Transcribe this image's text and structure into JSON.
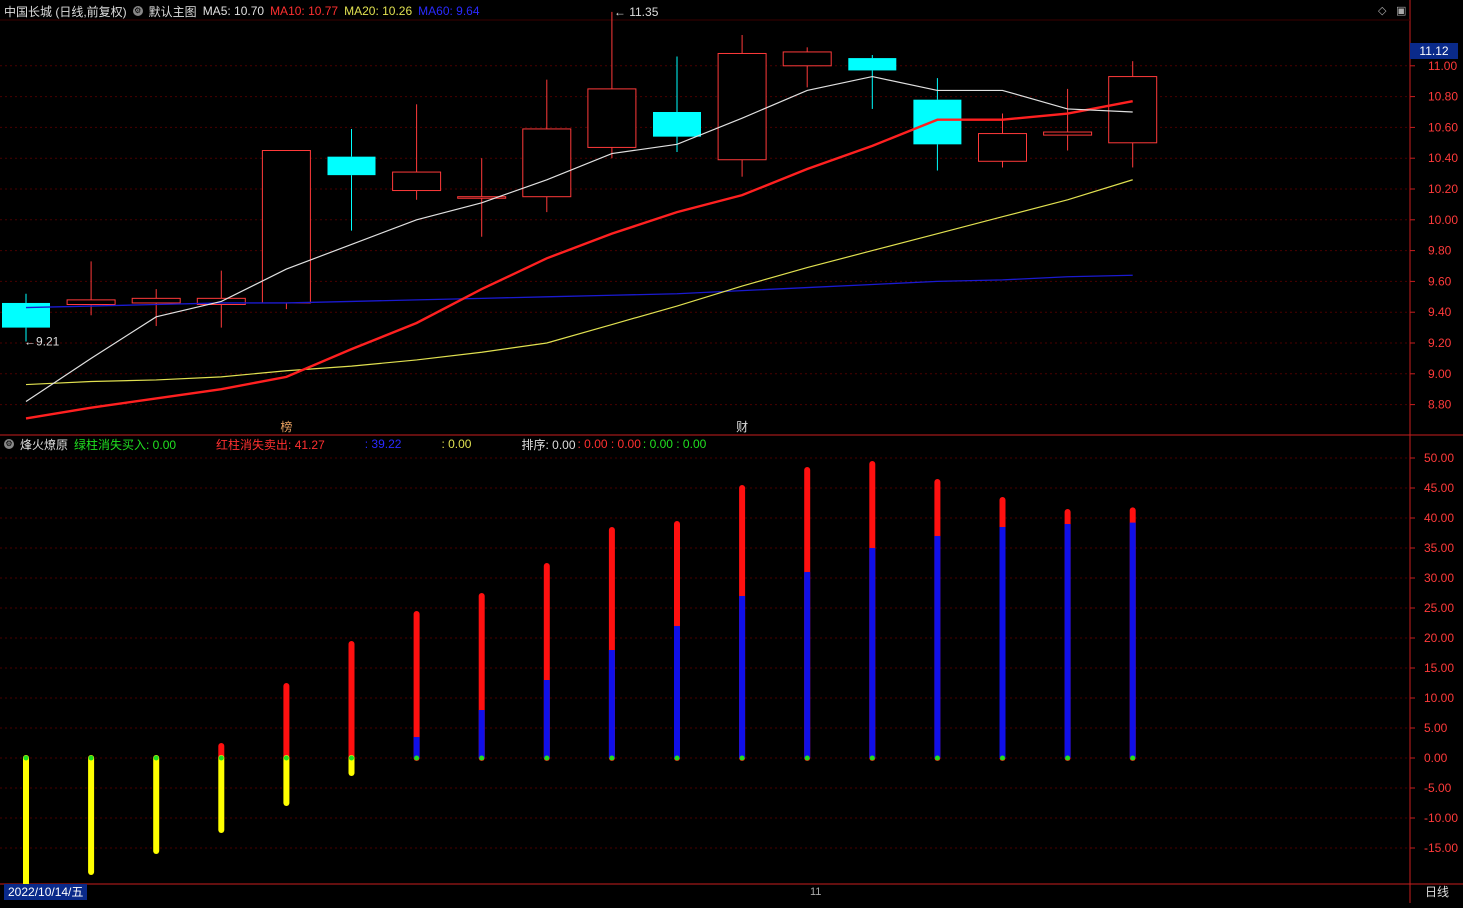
{
  "header": {
    "stock_label": "中国长城 (日线,前复权)",
    "main_chart_label": "默认主图",
    "ma5_label": "MA5: 10.70",
    "ma10_label": "MA10: 10.77",
    "ma20_label": "MA20: 10.26",
    "ma60_label": "MA60: 9.64"
  },
  "indicator_header": {
    "name": "烽火燎原",
    "green_label": "绿柱消失买入: 0.00",
    "red_label": "红柱消失卖出: 41.27",
    "blue_label": ": 39.22",
    "yellow_label": ": 0.00",
    "sort_label": "排序: 0.00",
    "sort_red": ": 0.00 : 0.00",
    "sort_green": ": 0.00 : 0.00"
  },
  "markers": {
    "bang": "榜",
    "cai": "财"
  },
  "footer": {
    "date": "2022/10/14/五",
    "period": "日线",
    "month": "11"
  },
  "colors": {
    "up": "#ff3a3a",
    "down": "#00ffff",
    "ma5": "#e0e0e0",
    "ma10": "#ff2020",
    "ma20": "#e0e050",
    "ma60": "#1a1ad0",
    "bar_red": "#ff1010",
    "bar_blue": "#1010e8",
    "bar_yellow": "#ffff00",
    "grid": "#4a0000",
    "axis": "#c81e1e"
  },
  "chart_data": [
    {
      "type": "candlestick",
      "ylim": [
        8.7,
        11.2
      ],
      "yticks": [
        "11.00",
        "10.80",
        "10.60",
        "10.40",
        "10.20",
        "10.00",
        "9.80",
        "9.60",
        "9.40",
        "9.20",
        "9.00",
        "8.80"
      ],
      "cursor_price": "11.12",
      "annotations": [
        {
          "text": "11.35"
        },
        {
          "text": "9.21"
        }
      ],
      "candles": [
        {
          "o": 9.46,
          "h": 9.52,
          "l": 9.21,
          "c": 9.3
        },
        {
          "o": 9.45,
          "h": 9.73,
          "l": 9.38,
          "c": 9.48
        },
        {
          "o": 9.46,
          "h": 9.55,
          "l": 9.31,
          "c": 9.49
        },
        {
          "o": 9.45,
          "h": 9.67,
          "l": 9.3,
          "c": 9.49
        },
        {
          "o": 9.46,
          "h": 10.45,
          "l": 9.42,
          "c": 10.45
        },
        {
          "o": 10.41,
          "h": 10.59,
          "l": 9.93,
          "c": 10.29
        },
        {
          "o": 10.19,
          "h": 10.75,
          "l": 10.13,
          "c": 10.31
        },
        {
          "o": 10.14,
          "h": 10.4,
          "l": 9.89,
          "c": 10.15
        },
        {
          "o": 10.15,
          "h": 10.91,
          "l": 10.05,
          "c": 10.59
        },
        {
          "o": 10.47,
          "h": 11.35,
          "l": 10.4,
          "c": 10.85
        },
        {
          "o": 10.7,
          "h": 11.06,
          "l": 10.44,
          "c": 10.54
        },
        {
          "o": 10.39,
          "h": 11.2,
          "l": 10.28,
          "c": 11.08
        },
        {
          "o": 11.0,
          "h": 11.12,
          "l": 10.86,
          "c": 11.09
        },
        {
          "o": 11.05,
          "h": 11.07,
          "l": 10.72,
          "c": 10.97
        },
        {
          "o": 10.78,
          "h": 10.92,
          "l": 10.32,
          "c": 10.49
        },
        {
          "o": 10.38,
          "h": 10.69,
          "l": 10.34,
          "c": 10.56
        },
        {
          "o": 10.55,
          "h": 10.85,
          "l": 10.45,
          "c": 10.57
        },
        {
          "o": 10.5,
          "h": 11.03,
          "l": 10.34,
          "c": 10.93
        }
      ],
      "ma5": [
        8.82,
        9.1,
        9.37,
        9.47,
        9.68,
        9.84,
        10.0,
        10.11,
        10.26,
        10.43,
        10.49,
        10.66,
        10.84,
        10.93,
        10.84,
        10.84,
        10.72,
        10.7
      ],
      "ma10": [
        8.71,
        8.78,
        8.84,
        8.9,
        8.98,
        9.16,
        9.33,
        9.55,
        9.75,
        9.91,
        10.05,
        10.16,
        10.33,
        10.48,
        10.65,
        10.65,
        10.69,
        10.77
      ],
      "ma20": [
        8.93,
        8.95,
        8.96,
        8.98,
        9.02,
        9.05,
        9.09,
        9.14,
        9.2,
        9.32,
        9.44,
        9.57,
        9.69,
        9.8,
        9.91,
        10.02,
        10.13,
        10.26
      ],
      "ma60": [
        9.43,
        9.44,
        9.45,
        9.46,
        9.46,
        9.47,
        9.48,
        9.49,
        9.5,
        9.51,
        9.52,
        9.54,
        9.56,
        9.58,
        9.6,
        9.61,
        9.63,
        9.64
      ]
    },
    {
      "type": "bar",
      "ylim": [
        -21,
        52
      ],
      "yticks": [
        "50.00",
        "45.00",
        "40.00",
        "35.00",
        "30.00",
        "25.00",
        "20.00",
        "15.00",
        "10.00",
        "5.00",
        "0.00",
        "-5.00",
        "-10.00",
        "-15.00"
      ],
      "red": [
        0,
        0,
        0,
        2,
        12,
        19,
        24,
        27,
        32,
        38,
        39,
        45,
        48,
        49,
        46,
        43,
        41,
        41.27
      ],
      "blue": [
        0,
        0,
        0,
        0,
        0,
        0,
        3.5,
        8,
        13,
        18,
        22,
        27,
        31,
        35,
        37,
        38.5,
        39,
        39.22
      ],
      "yellow": [
        -22,
        -19,
        -15.5,
        -12,
        -7.5,
        -2.5,
        0,
        0,
        0,
        0,
        0,
        0,
        0,
        0,
        0,
        0,
        0,
        0
      ]
    }
  ]
}
